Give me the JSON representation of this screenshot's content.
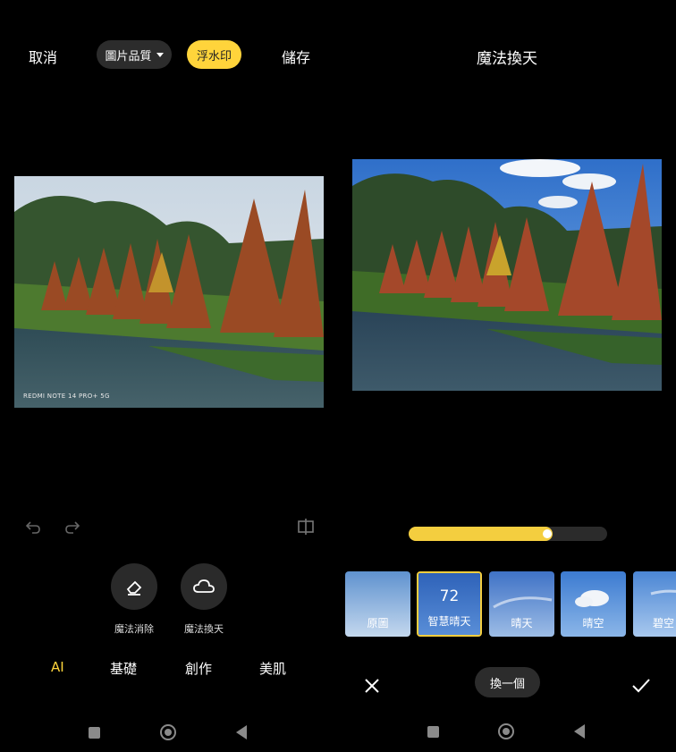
{
  "left_header": {
    "cancel": "取消",
    "quality": "圖片品質",
    "watermark": "浮水印",
    "save": "儲存"
  },
  "right_header": {
    "title": "魔法換天"
  },
  "photo": {
    "watermark_text": "REDMI NOTE 14 PRO+ 5G"
  },
  "tools": [
    {
      "label": "魔法消除",
      "icon": "eraser-icon"
    },
    {
      "label": "魔法換天",
      "icon": "cloud-icon"
    }
  ],
  "tabs": [
    {
      "label": "AI",
      "active": true
    },
    {
      "label": "基礎",
      "active": false
    },
    {
      "label": "創作",
      "active": false
    },
    {
      "label": "美肌",
      "active": false
    }
  ],
  "slider": {
    "value_fraction": 0.7
  },
  "filters": [
    {
      "label": "原圖",
      "selected": false
    },
    {
      "label": "智慧晴天",
      "selected": true,
      "value": "72"
    },
    {
      "label": "晴天",
      "selected": false
    },
    {
      "label": "晴空",
      "selected": false
    },
    {
      "label": "碧空",
      "selected": false
    }
  ],
  "actions": {
    "swap": "換一個"
  },
  "colors": {
    "accent": "#ffd43b",
    "background": "#000000"
  }
}
